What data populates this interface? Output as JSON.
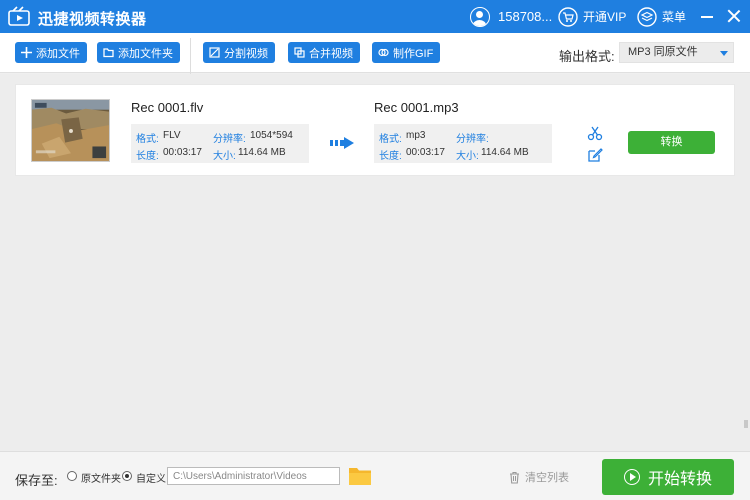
{
  "app": {
    "title": "迅捷视频转换器"
  },
  "header": {
    "user_name": "158708...",
    "vip_label": "开通VIP",
    "menu_label": "菜单"
  },
  "toolbar": {
    "add_file": "添加文件",
    "add_folder": "添加文件夹",
    "split_video": "分割视频",
    "merge_video": "合并视频",
    "make_gif": "制作GIF",
    "output_format_label": "输出格式:",
    "output_format_value": "MP3  同原文件"
  },
  "file_list": [
    {
      "source": {
        "name": "Rec 0001.flv",
        "format_label": "格式:",
        "format": "FLV",
        "resolution_label": "分辨率:",
        "resolution": "1054*594",
        "duration_label": "长度:",
        "duration": "00:03:17",
        "size_label": "大小:",
        "size": "114.64 MB"
      },
      "target": {
        "name": "Rec 0001.mp3",
        "format_label": "格式:",
        "format": "mp3",
        "resolution_label": "分辨率:",
        "resolution": "",
        "duration_label": "长度:",
        "duration": "00:03:17",
        "size_label": "大小:",
        "size": "114.64 MB"
      },
      "convert_label": "转换"
    }
  ],
  "footer": {
    "save_to_label": "保存至:",
    "option_original": "原文件夹",
    "option_custom": "自定义",
    "selected_option": "custom",
    "path_value": "C:\\Users\\Administrator\\Videos",
    "clear_list_label": "清空列表",
    "start_label": "开始转换"
  },
  "colors": {
    "primary": "#1f7fe0",
    "success": "#3db037",
    "background": "#ededed"
  },
  "icons": [
    "app-logo-icon",
    "user-avatar-icon",
    "vip-cart-icon",
    "menu-layers-icon",
    "minimize-icon",
    "close-icon",
    "plus-icon",
    "folder-icon",
    "split-icon",
    "merge-icon",
    "gif-icon",
    "dropdown-arrow-icon",
    "convert-arrow-icon",
    "scissors-icon",
    "edit-icon",
    "trash-icon",
    "play-icon"
  ]
}
